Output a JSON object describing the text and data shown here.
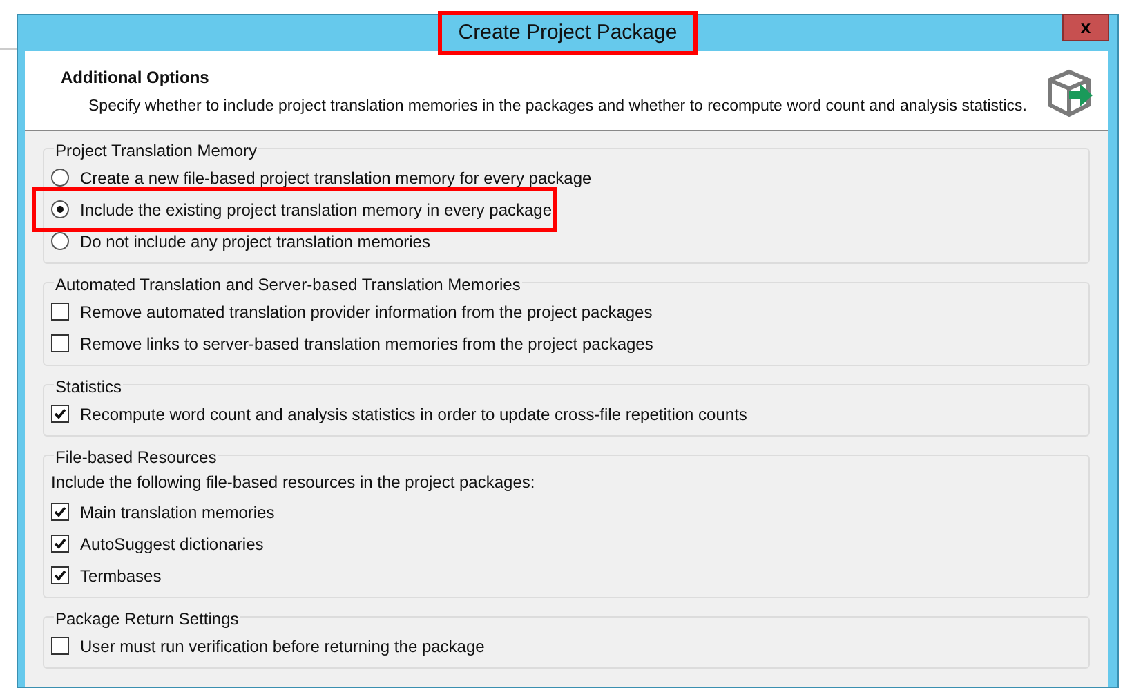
{
  "window": {
    "title": "Create Project Package",
    "close": "x"
  },
  "header": {
    "title": "Additional Options",
    "description": "Specify whether to include project translation memories in the packages and whether to recompute word count and analysis statistics."
  },
  "groups": [
    {
      "title": "Project Translation Memory",
      "items": [
        {
          "kind": "radio",
          "label": "Create a new file-based project translation memory for every package",
          "selected": false
        },
        {
          "kind": "radio",
          "label": "Include the existing project translation memory in every package",
          "selected": true
        },
        {
          "kind": "radio",
          "label": "Do not include any project translation memories",
          "selected": false
        }
      ]
    },
    {
      "title": "Automated Translation and Server-based Translation Memories",
      "items": [
        {
          "kind": "checkbox",
          "label": "Remove automated translation provider information from the project packages",
          "checked": false
        },
        {
          "kind": "checkbox",
          "label": "Remove links to server-based translation memories from the project packages",
          "checked": false
        }
      ]
    },
    {
      "title": "Statistics",
      "items": [
        {
          "kind": "checkbox",
          "label": "Recompute word count and analysis statistics in order to update cross-file repetition counts",
          "checked": true
        }
      ]
    },
    {
      "title": "File-based Resources",
      "items": [
        {
          "kind": "text",
          "label": "Include the following file-based resources in the project packages:"
        },
        {
          "kind": "checkbox",
          "label": "Main translation memories",
          "checked": true
        },
        {
          "kind": "checkbox",
          "label": "AutoSuggest dictionaries",
          "checked": true
        },
        {
          "kind": "checkbox",
          "label": "Termbases",
          "checked": true
        }
      ]
    },
    {
      "title": "Package Return Settings",
      "items": [
        {
          "kind": "checkbox",
          "label": "User must run verification before returning the package",
          "checked": false
        }
      ]
    }
  ]
}
